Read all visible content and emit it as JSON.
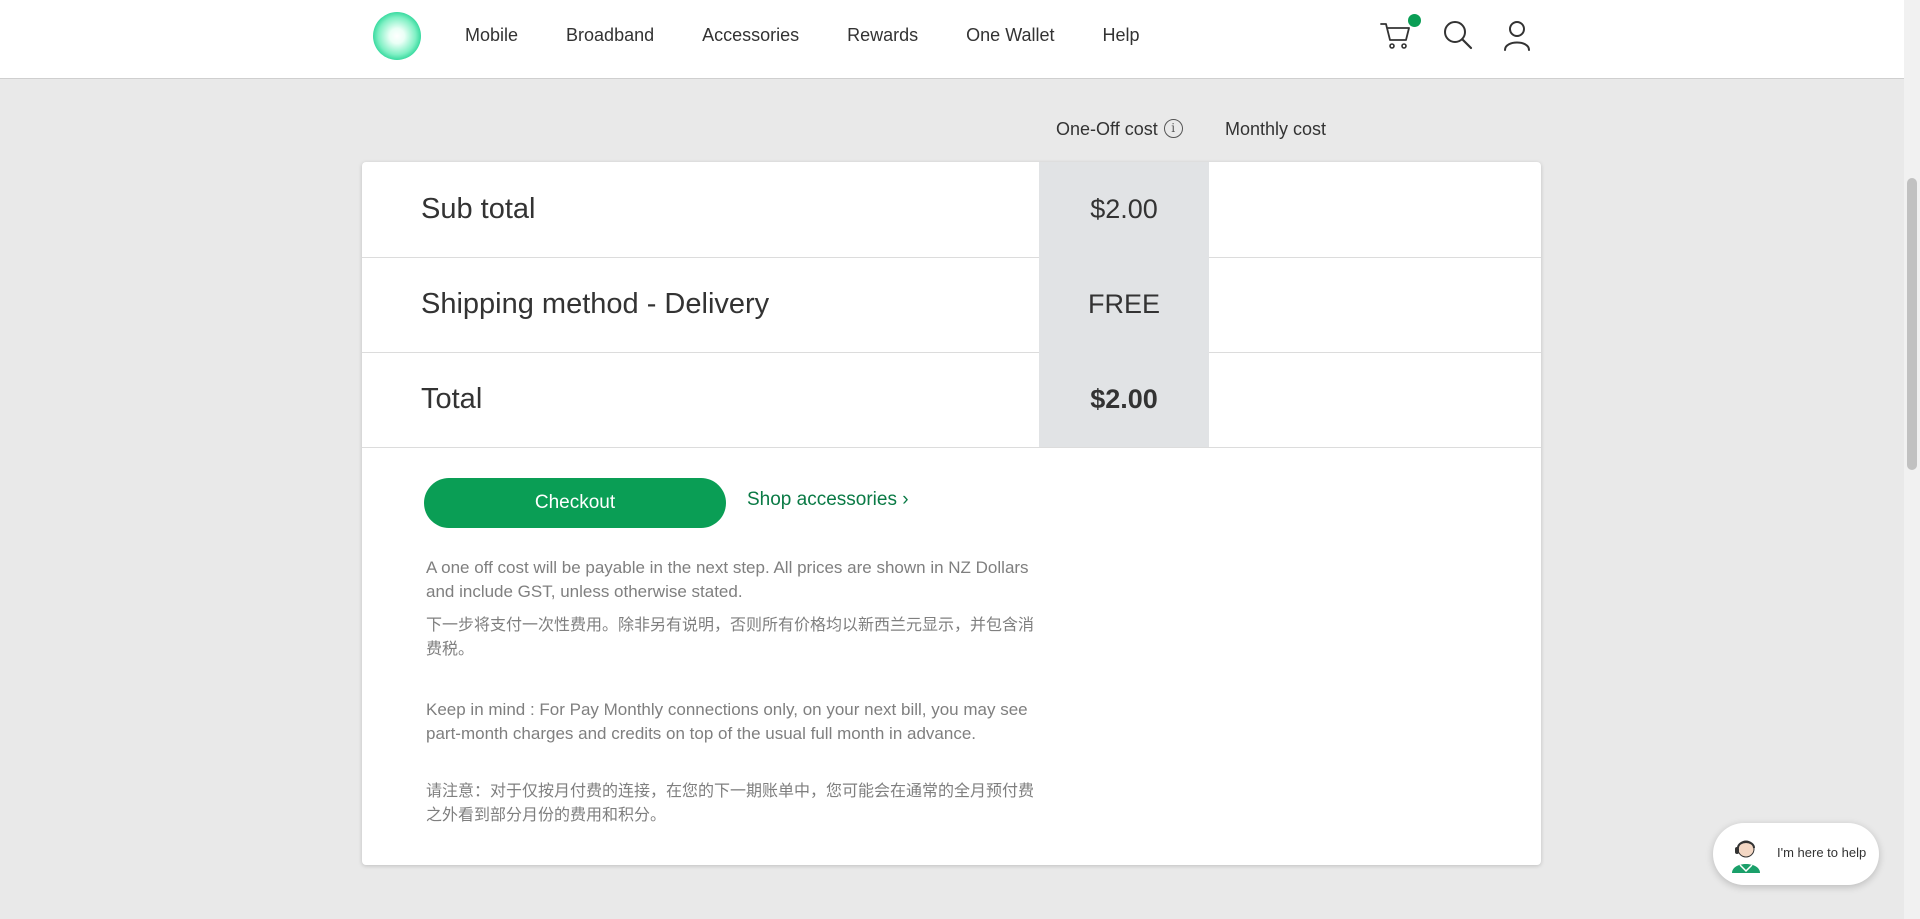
{
  "header": {
    "nav": [
      "Mobile",
      "Broadband",
      "Accessories",
      "Rewards",
      "One Wallet",
      "Help"
    ],
    "icons": [
      "cart-icon",
      "search-icon",
      "account-icon"
    ],
    "accent_color": "#0a9e55"
  },
  "columns": {
    "one_off": "One-Off cost",
    "monthly": "Monthly cost"
  },
  "summary": {
    "rows": [
      {
        "label": "Sub total",
        "one_off": "$2.00",
        "monthly": ""
      },
      {
        "label": "Shipping method - Delivery",
        "one_off": "FREE",
        "monthly": ""
      },
      {
        "label": "Total",
        "one_off": "$2.00",
        "monthly": ""
      }
    ]
  },
  "actions": {
    "checkout": "Checkout",
    "shop_link": "Shop accessories"
  },
  "notes": {
    "cost_en": "A one off cost will be payable in the next step. All prices are shown in NZ Dollars and include GST, unless otherwise stated.",
    "cost_zh": "下一步将支付一次性费用。除非另有说明，否则所有价格均以新西兰元显示，并包含消费税。",
    "keep_en": "Keep in mind : For Pay Monthly connections only, on your next bill, you may see part-month charges and credits on top of the usual full month in advance.",
    "keep_zh": "请注意：对于仅按月付费的连接，在您的下一期账单中，您可能会在通常的全月预付费之外看到部分月份的费用和积分。"
  },
  "chat": {
    "label": "I'm here to help"
  }
}
